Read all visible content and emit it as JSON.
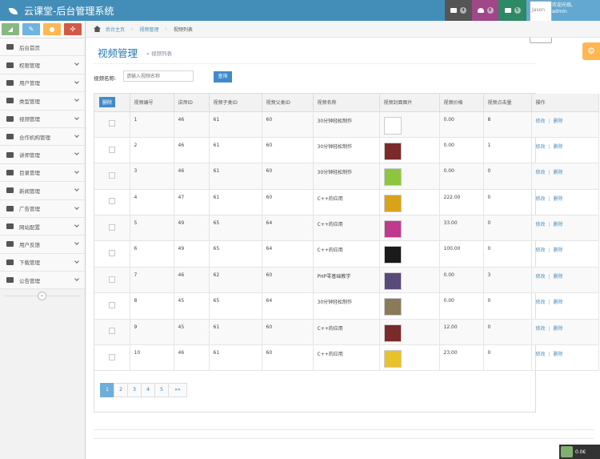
{
  "app": {
    "title": "云课堂-后台管理系统"
  },
  "topnav": {
    "notifications": [
      {
        "icon": "tasks-icon",
        "count": "4",
        "color": "#555555"
      },
      {
        "icon": "bell-icon",
        "count": "8",
        "color": "#a0478a"
      },
      {
        "icon": "envelope-icon",
        "count": "5",
        "color": "#2e8965"
      }
    ],
    "avatar_alt": "Jason",
    "welcome": "欢迎光临,",
    "username": "admin"
  },
  "sidebar": {
    "shortcut_colors": [
      "#87b87f",
      "#6fb3e0",
      "#ffb752",
      "#d15b47"
    ],
    "items": [
      {
        "label": "后台首页",
        "icon": "dashboard-icon",
        "chevron": false
      },
      {
        "label": "权限管理",
        "icon": "lock-icon",
        "chevron": true
      },
      {
        "label": "用户管理",
        "icon": "users-icon",
        "chevron": true
      },
      {
        "label": "类型管理",
        "icon": "list-icon",
        "chevron": true
      },
      {
        "label": "视频管理",
        "icon": "music-icon",
        "chevron": true
      },
      {
        "label": "合作机构管理",
        "icon": "edit-icon",
        "chevron": true
      },
      {
        "label": "讲师管理",
        "icon": "user-icon",
        "chevron": true
      },
      {
        "label": "目录管理",
        "icon": "list-alt-icon",
        "chevron": true
      },
      {
        "label": "新闻管理",
        "icon": "file-icon",
        "chevron": true
      },
      {
        "label": "广告管理",
        "icon": "bullhorn-icon",
        "chevron": true
      },
      {
        "label": "网站配置",
        "icon": "cogs-icon",
        "chevron": true
      },
      {
        "label": "用户反馈",
        "icon": "folder-open-icon",
        "chevron": true
      },
      {
        "label": "下载管理",
        "icon": "download-icon",
        "chevron": true
      },
      {
        "label": "公告管理",
        "icon": "credit-card-icon",
        "chevron": true
      }
    ]
  },
  "breadcrumb": {
    "home": "后台主页",
    "section": "视频管理",
    "current": "视频列表"
  },
  "page": {
    "title": "视频管理",
    "subtitle": "» 视频列表"
  },
  "search": {
    "label": "视频名称:",
    "placeholder": "请输入视频名称",
    "button": "查询"
  },
  "table": {
    "delete_all": "删除",
    "columns": [
      "视频编号",
      "讲师ID",
      "视频子类ID",
      "视频父类ID",
      "视频名称",
      "视频封面图片",
      "视频价格",
      "视频点击量",
      "操作"
    ],
    "rows": [
      {
        "id": "1",
        "teacher": "46",
        "sub": "61",
        "parent": "60",
        "name": "30分钟轻松制作",
        "thumb": "#ffffff",
        "price": "0.00",
        "clicks": "8"
      },
      {
        "id": "2",
        "teacher": "46",
        "sub": "61",
        "parent": "60",
        "name": "30分钟轻松制作",
        "thumb": "#7a2a2a",
        "price": "0.00",
        "clicks": "1"
      },
      {
        "id": "3",
        "teacher": "46",
        "sub": "61",
        "parent": "60",
        "name": "30分钟轻松制作",
        "thumb": "#8cc63f",
        "price": "0.00",
        "clicks": "0"
      },
      {
        "id": "4",
        "teacher": "47",
        "sub": "61",
        "parent": "60",
        "name": "C++的应用",
        "thumb": "#d9a21b",
        "price": "222.00",
        "clicks": "0"
      },
      {
        "id": "5",
        "teacher": "49",
        "sub": "65",
        "parent": "64",
        "name": "C++的应用",
        "thumb": "#c0398e",
        "price": "33.00",
        "clicks": "0"
      },
      {
        "id": "6",
        "teacher": "49",
        "sub": "65",
        "parent": "64",
        "name": "C++的应用",
        "thumb": "#1a1a1a",
        "price": "100.00",
        "clicks": "0"
      },
      {
        "id": "7",
        "teacher": "46",
        "sub": "62",
        "parent": "60",
        "name": "PHP零基础教学",
        "thumb": "#5a4a7a",
        "price": "0.00",
        "clicks": "3"
      },
      {
        "id": "8",
        "teacher": "45",
        "sub": "65",
        "parent": "64",
        "name": "30分钟轻松制作",
        "thumb": "#8a7a5a",
        "price": "0.00",
        "clicks": "0"
      },
      {
        "id": "9",
        "teacher": "45",
        "sub": "61",
        "parent": "60",
        "name": "C++的应用",
        "thumb": "#7a2a2a",
        "price": "12.00",
        "clicks": "0"
      },
      {
        "id": "10",
        "teacher": "46",
        "sub": "61",
        "parent": "60",
        "name": "C++的应用",
        "thumb": "#e8c22a",
        "price": "23.00",
        "clicks": "0"
      }
    ],
    "edit_label": "修改",
    "delete_label": "删除",
    "separator": "|"
  },
  "pagination": {
    "pages": [
      "1",
      "2",
      "3",
      "4",
      "5"
    ],
    "next": "»»",
    "active": "1"
  },
  "widget": {
    "text": "0.0€"
  }
}
